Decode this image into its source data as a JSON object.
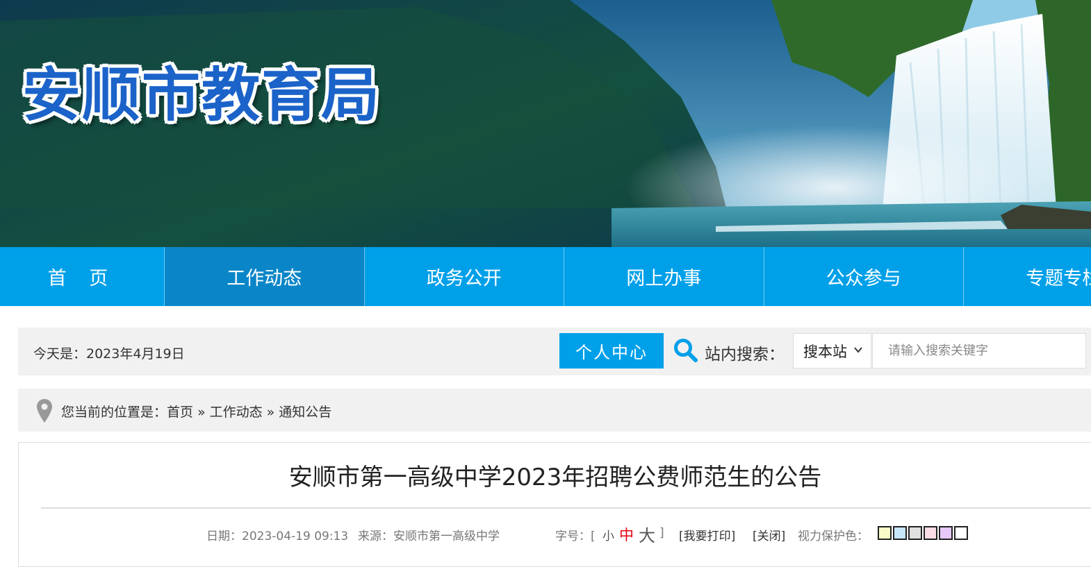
{
  "banner": {
    "title": "安顺市教育局"
  },
  "nav": {
    "items": [
      {
        "label": "首 页"
      },
      {
        "label": "工作动态"
      },
      {
        "label": "政务公开"
      },
      {
        "label": "网上办事"
      },
      {
        "label": "公众参与"
      },
      {
        "label": "专题专栏"
      }
    ],
    "active_index": 1
  },
  "infobar": {
    "today": "今天是：2023年4月19日",
    "personal_center": "个人中心",
    "search_label": "站内搜索：",
    "scope_selected": "搜本站",
    "search_placeholder": "请输入搜索关键字"
  },
  "breadcrumb": {
    "prefix": "您当前的位置是：",
    "items": [
      "首页",
      "工作动态",
      "通知公告"
    ],
    "separator": "»"
  },
  "article": {
    "title": "安顺市第一高级中学2023年招聘公费师范生的公告",
    "date_label": "日期：2023-04-19 09:13",
    "source_label": "来源：安顺市第一高级中学",
    "font_size_label": "字号：[",
    "font_small": "小",
    "font_medium": "中",
    "font_large": "大",
    "font_close_bracket": "]",
    "print_label": "[我要打印]",
    "close_label": "[关闭]",
    "eye_care_label": "视力保护色：",
    "eye_care_colors": [
      "#fafac8",
      "#c8e6fa",
      "#e0e0e0",
      "#fadce6",
      "#e6c8fa",
      "#ffffff"
    ]
  },
  "colors": {
    "nav_bg": "#00a0e9",
    "nav_active": "#0a86c8",
    "accent_red": "#e60012"
  }
}
